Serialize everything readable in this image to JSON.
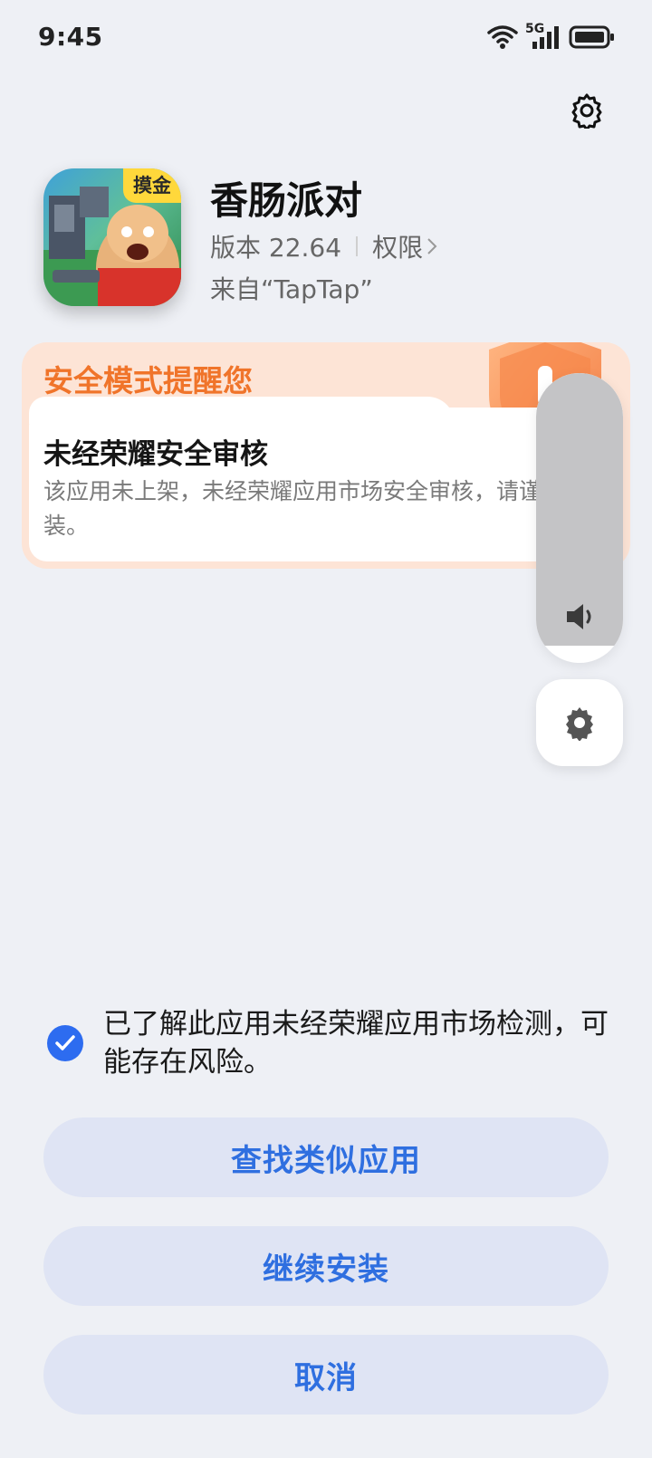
{
  "status_bar": {
    "time": "9:45",
    "network": "5G",
    "icons": [
      "wifi-icon",
      "signal-icon",
      "battery-icon"
    ]
  },
  "app": {
    "name": "香肠派对",
    "icon_badge": "摸金",
    "version": "版本 22.64",
    "permissions_label": "权限",
    "source": "来自“TapTap”"
  },
  "warning": {
    "title": "安全模式提醒您",
    "subtitle": "未经荣耀安全审核",
    "description": "该应用未上架，未经荣耀应用市场安全审核，请谨慎安装。"
  },
  "volume": {
    "level": 0.94
  },
  "acknowledge": {
    "checked": true,
    "text": "已了解此应用未经荣耀应用市场检测，可能存在风险。"
  },
  "buttons": {
    "find_similar": "查找类似应用",
    "continue_install": "继续安装",
    "cancel": "取消"
  },
  "colors": {
    "accent": "#2f6fe0",
    "warning": "#f0742a",
    "button_bg": "#dfe4f4",
    "page_bg": "#eef0f5"
  }
}
